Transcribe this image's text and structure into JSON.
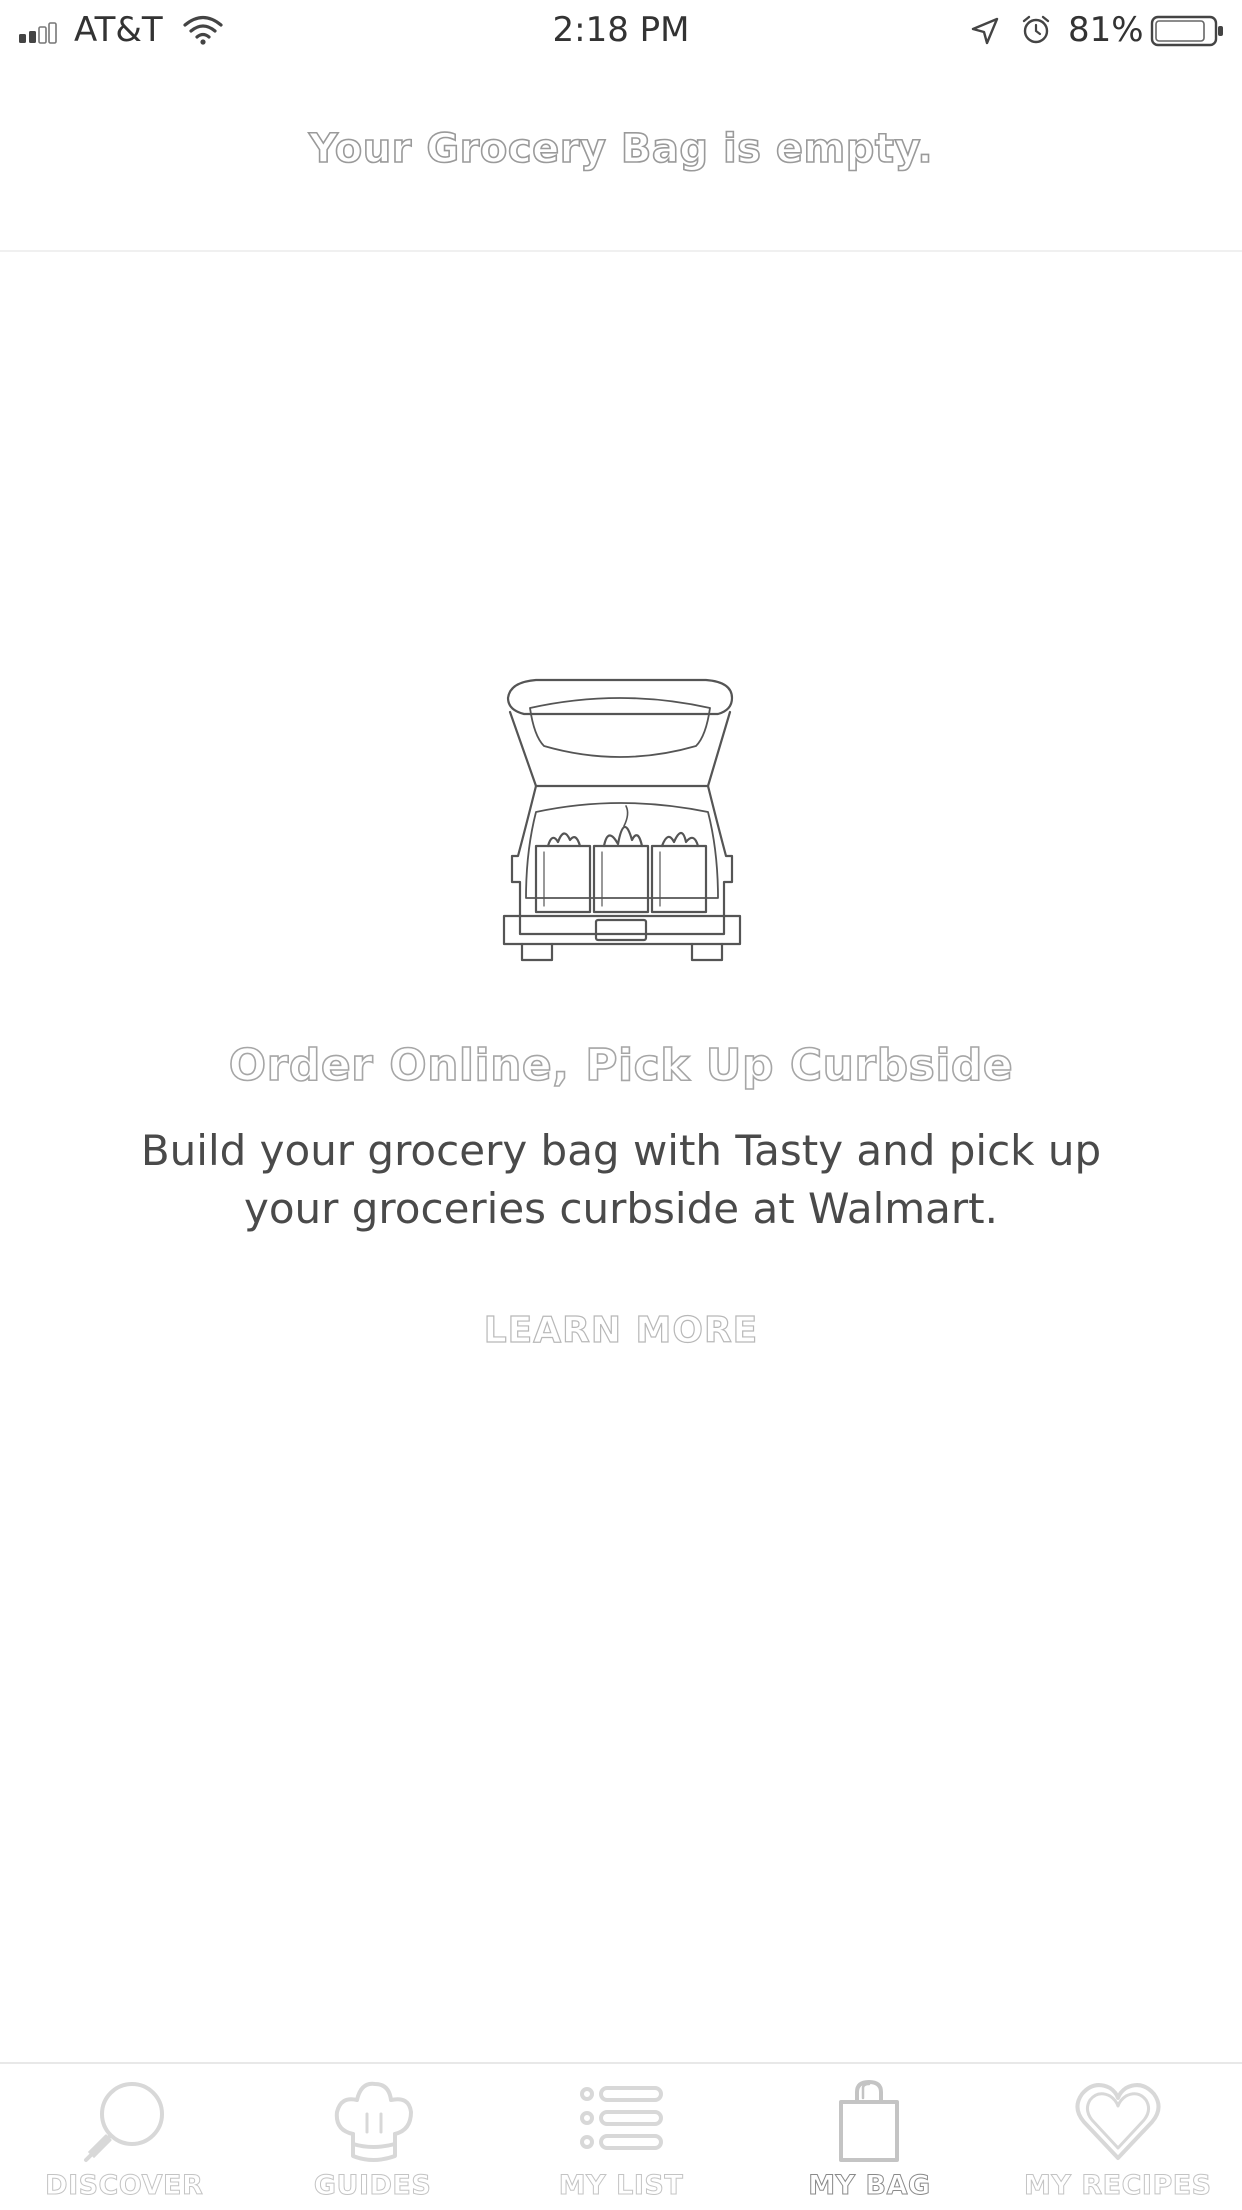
{
  "status_bar": {
    "carrier": "AT&T",
    "time": "2:18 PM",
    "battery": "81%",
    "icons": [
      "signal-icon",
      "wifi-icon",
      "location-icon",
      "alarm-icon",
      "battery-icon"
    ]
  },
  "header": {
    "title": "Your Grocery Bag is empty."
  },
  "empty_state": {
    "illustration": "car-trunk-groceries-illustration",
    "title": "Order Online, Pick Up Curbside",
    "description": "Build your grocery bag with Tasty and pick up your groceries curbside at Walmart.",
    "learn_more": "LEARN MORE"
  },
  "tab_bar": {
    "active": "MY BAG",
    "tabs": [
      {
        "label": "DISCOVER",
        "icon": "search-icon"
      },
      {
        "label": "GUIDES",
        "icon": "chef-hat-icon"
      },
      {
        "label": "MY LIST",
        "icon": "list-icon"
      },
      {
        "label": "MY BAG",
        "icon": "shopping-bag-icon"
      },
      {
        "label": "MY RECIPES",
        "icon": "heart-icon"
      }
    ]
  },
  "colors": {
    "background": "#ffffff",
    "text": "#4a4a4a",
    "outline_text": "#9a9a9a",
    "divider": "#e8e8e8"
  }
}
